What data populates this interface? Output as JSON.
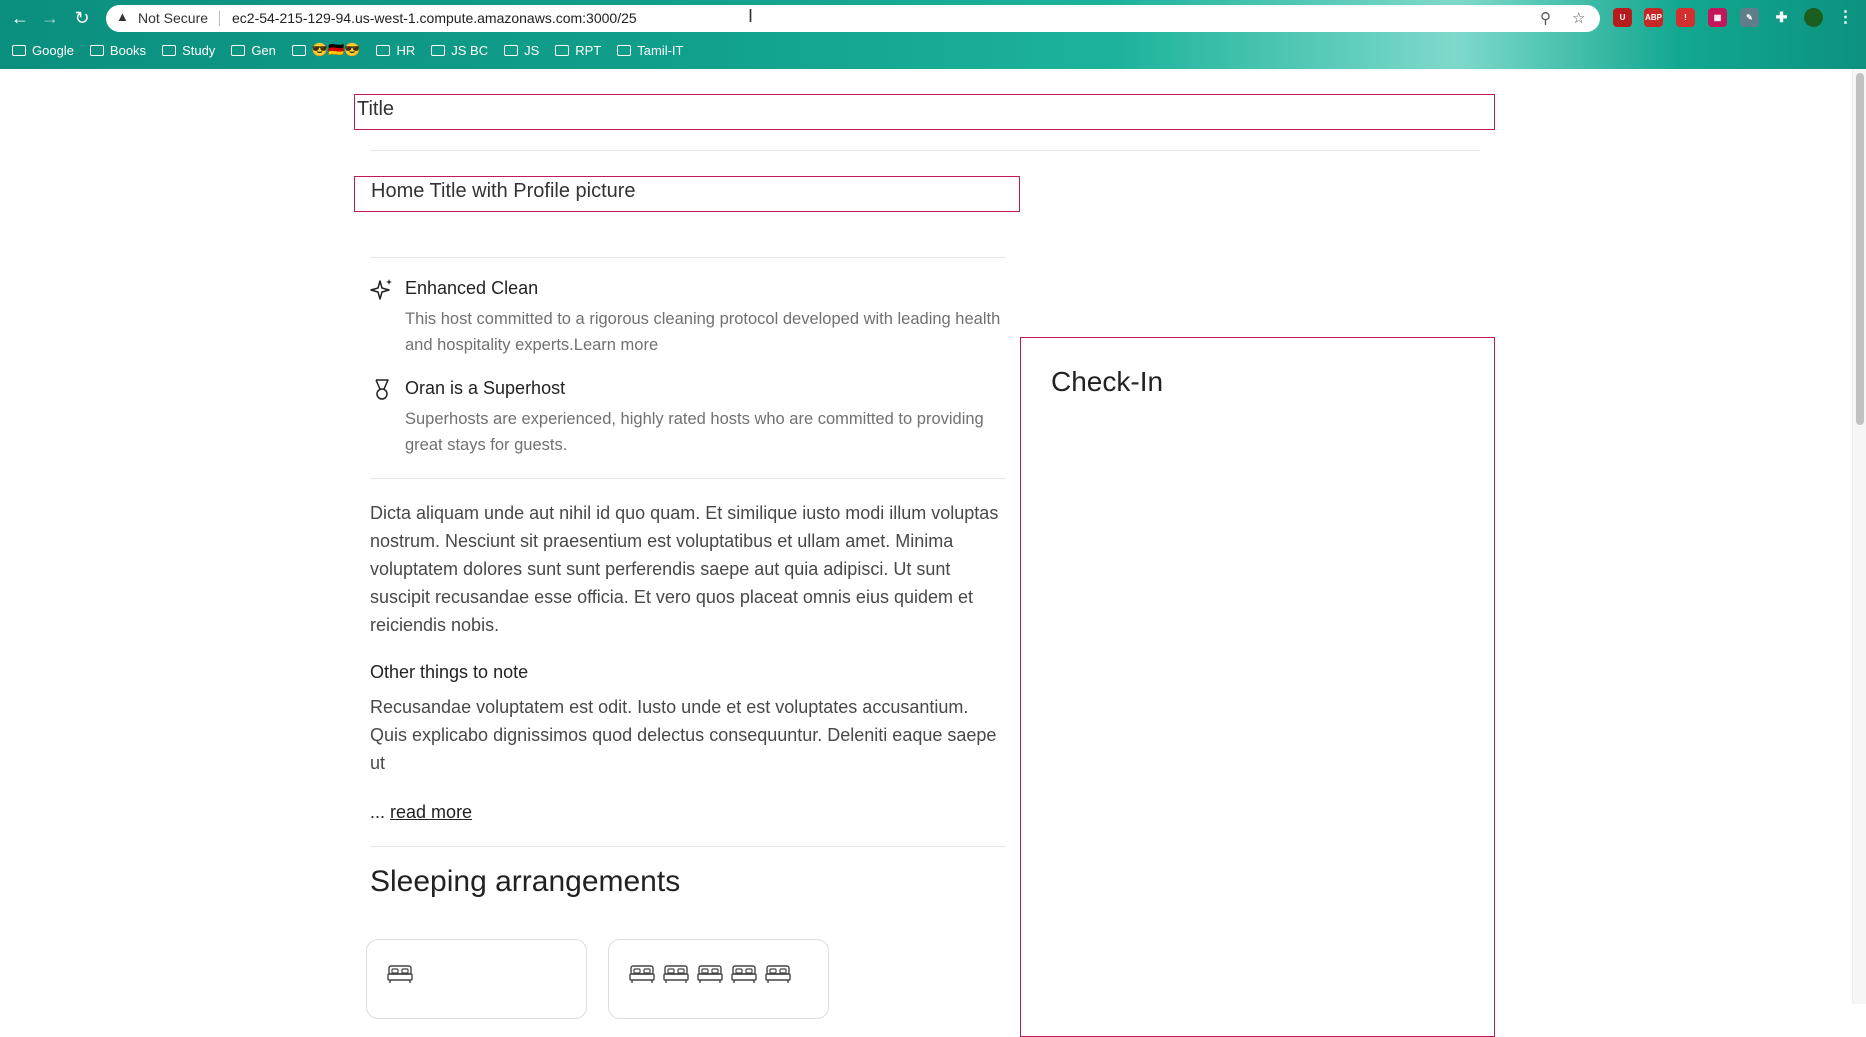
{
  "browser": {
    "security_label": "Not Secure",
    "url": "ec2-54-215-129-94.us-west-1.compute.amazonaws.com:3000/25",
    "bookmarks": [
      {
        "label": "Google"
      },
      {
        "label": "Books"
      },
      {
        "label": "Study"
      },
      {
        "label": "Gen"
      },
      {
        "label": "😎🇩🇪😎"
      },
      {
        "label": "HR"
      },
      {
        "label": "JS BC"
      },
      {
        "label": "JS"
      },
      {
        "label": "RPT"
      },
      {
        "label": "Tamil-IT"
      }
    ],
    "extensions": [
      {
        "name": "ublock-icon",
        "text": "U",
        "color": "#b71c1c"
      },
      {
        "name": "adblock-icon",
        "text": "ABP",
        "color": "#c62828"
      },
      {
        "name": "red-extension-icon",
        "text": "!",
        "color": "#d32f2f"
      },
      {
        "name": "gallery-extension-icon",
        "text": "▦",
        "color": "#c2185b"
      },
      {
        "name": "tools-extension-icon",
        "text": "✎",
        "color": "#607d8b"
      },
      {
        "name": "puzzle-icon",
        "text": "✚",
        "color": "#333333"
      },
      {
        "name": "profile-avatar-icon",
        "text": "●",
        "color": "#1b5e20"
      }
    ]
  },
  "listing": {
    "title": "Title",
    "home_title": "Home Title with Profile picture",
    "features": [
      {
        "icon": "sparkle-icon",
        "title": "Enhanced Clean",
        "description": "This host committed to a rigorous cleaning protocol developed with leading health and hospitality experts.Learn more"
      },
      {
        "icon": "medal-icon",
        "title": "Oran is a Superhost",
        "description": "Superhosts are experienced, highly rated hosts who are committed to providing great stays for guests."
      }
    ],
    "description": "Dicta aliquam unde aut nihil id quo quam. Et similique iusto modi illum voluptas nostrum. Nesciunt sit praesentium est voluptatibus et ullam amet. Minima voluptatem dolores sunt sunt perferendis saepe aut quia adipisci. Ut sunt suscipit recusandae esse officia. Et vero quos placeat omnis eius quidem et reiciendis nobis.",
    "other_heading": "Other things to note",
    "other_text": "Recusandae voluptatem est odit. Iusto unde et est voluptates accusantium. Quis explicabo dignissimos quod delectus consequuntur. Deleniti eaque saepe ut",
    "ellipsis": "...",
    "read_more": "read more",
    "sleeping_heading": "Sleeping arrangements",
    "bedrooms": [
      {
        "beds": 1
      },
      {
        "beds": 5
      }
    ]
  },
  "checkin": {
    "heading": "Check-In"
  },
  "colors": {
    "accent_border": "#c2185b",
    "chrome_teal": "#109f8a"
  }
}
